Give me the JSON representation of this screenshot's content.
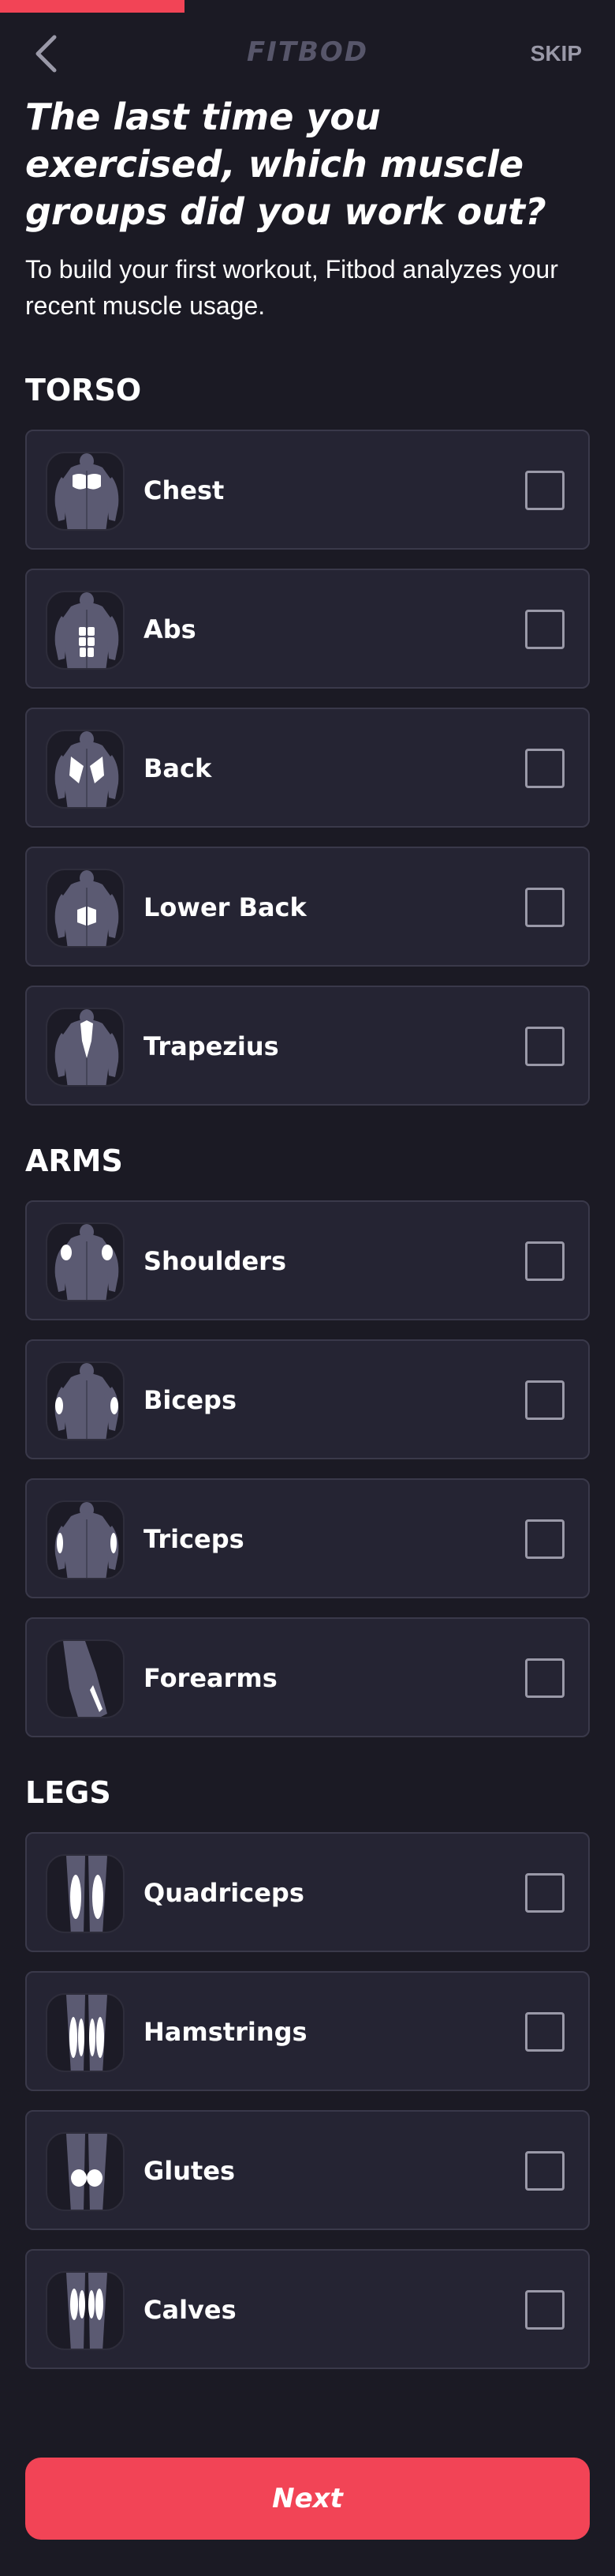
{
  "progress": {
    "fraction": 0.3
  },
  "header": {
    "back_icon": "chevron-left-icon",
    "brand": "FITBOD",
    "skip_label": "SKIP"
  },
  "question": {
    "title": "The last time you exercised, which muscle groups did you work out?",
    "subtitle": "To build your first workout, Fitbod analyzes your recent muscle usage."
  },
  "sections": [
    {
      "title": "TORSO",
      "items": [
        {
          "label": "Chest",
          "icon": "chest-muscle-icon",
          "checked": false
        },
        {
          "label": "Abs",
          "icon": "abs-muscle-icon",
          "checked": false
        },
        {
          "label": "Back",
          "icon": "back-muscle-icon",
          "checked": false
        },
        {
          "label": "Lower Back",
          "icon": "lower-back-muscle-icon",
          "checked": false
        },
        {
          "label": "Trapezius",
          "icon": "trapezius-muscle-icon",
          "checked": false
        }
      ]
    },
    {
      "title": "ARMS",
      "items": [
        {
          "label": "Shoulders",
          "icon": "shoulders-muscle-icon",
          "checked": false
        },
        {
          "label": "Biceps",
          "icon": "biceps-muscle-icon",
          "checked": false
        },
        {
          "label": "Triceps",
          "icon": "triceps-muscle-icon",
          "checked": false
        },
        {
          "label": "Forearms",
          "icon": "forearms-muscle-icon",
          "checked": false
        }
      ]
    },
    {
      "title": "LEGS",
      "items": [
        {
          "label": "Quadriceps",
          "icon": "quadriceps-muscle-icon",
          "checked": false
        },
        {
          "label": "Hamstrings",
          "icon": "hamstrings-muscle-icon",
          "checked": false
        },
        {
          "label": "Glutes",
          "icon": "glutes-muscle-icon",
          "checked": false
        },
        {
          "label": "Calves",
          "icon": "calves-muscle-icon",
          "checked": false
        }
      ]
    }
  ],
  "footer": {
    "next_label": "Next"
  },
  "colors": {
    "accent": "#f24456",
    "background": "#1b1a24",
    "card": "#252433",
    "muscle": "#5b5a72",
    "highlight": "#ffffff"
  }
}
